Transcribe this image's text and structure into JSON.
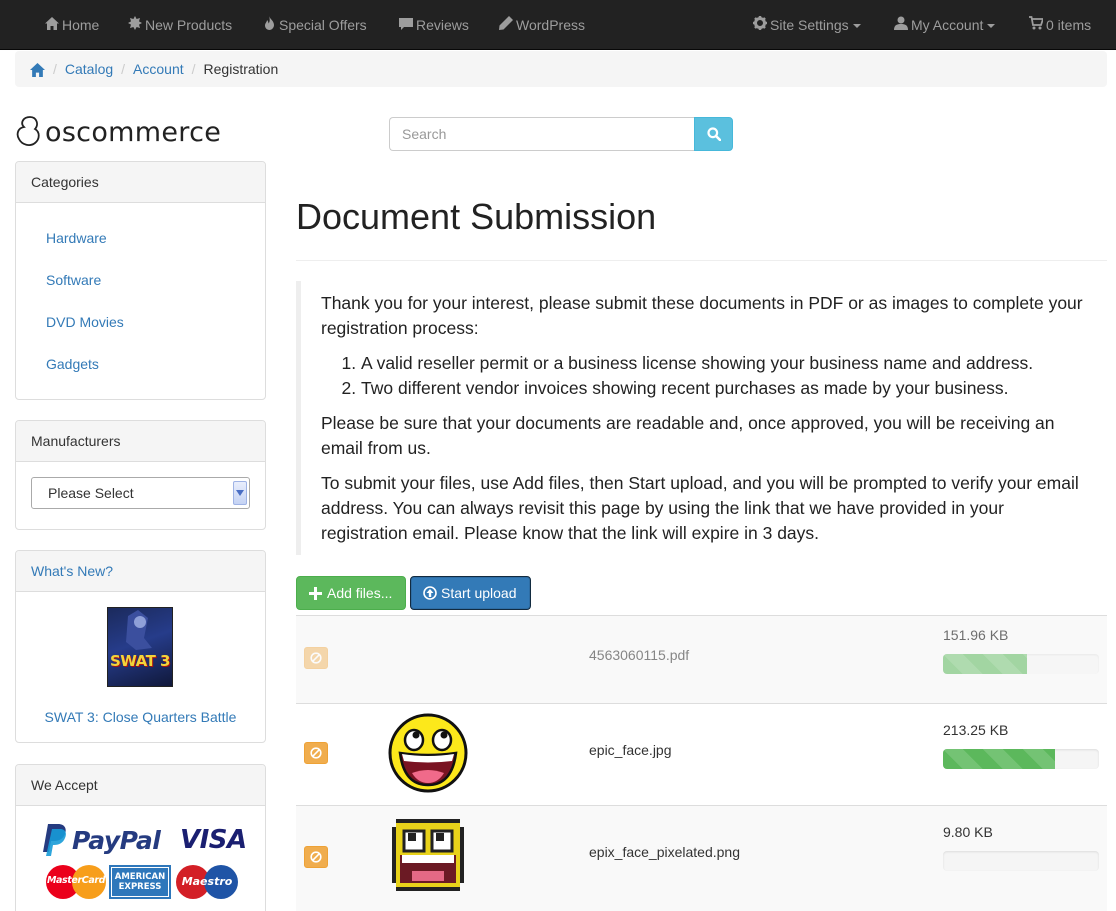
{
  "nav": {
    "left": [
      {
        "label": "Home",
        "icon": "home-icon"
      },
      {
        "label": "New Products",
        "icon": "certificate-icon"
      },
      {
        "label": "Special Offers",
        "icon": "fire-icon"
      },
      {
        "label": "Reviews",
        "icon": "comment-icon"
      },
      {
        "label": "WordPress",
        "icon": "pencil-icon"
      }
    ],
    "right": [
      {
        "label": "Site Settings",
        "icon": "cog-icon"
      },
      {
        "label": "My Account",
        "icon": "user-icon"
      },
      {
        "label": "0 items",
        "icon": "cart-icon"
      }
    ]
  },
  "breadcrumb": {
    "items": [
      "Catalog",
      "Account"
    ],
    "active": "Registration"
  },
  "logo": {
    "text": "oscommerce"
  },
  "search": {
    "placeholder": "Search"
  },
  "sidebar": {
    "categories": {
      "heading": "Categories",
      "items": [
        "Hardware",
        "Software",
        "DVD Movies",
        "Gadgets"
      ]
    },
    "manufacturers": {
      "heading": "Manufacturers",
      "selected": "Please Select"
    },
    "whats_new": {
      "heading": "What's New?",
      "product": "SWAT 3: Close Quarters Battle",
      "box_art_text": "SWAT 3"
    },
    "we_accept": {
      "heading": "We Accept",
      "logos": [
        "PayPal",
        "VISA",
        "MasterCard",
        "AMERICAN EXPRESS",
        "Maestro"
      ]
    }
  },
  "main": {
    "title": "Document Submission",
    "intro": "Thank you for your interest, please submit these documents in PDF or as images to complete your registration process:",
    "requirements": [
      "A valid reseller permit or a business license showing your business name and address.",
      "Two different vendor invoices showing recent purchases as made by your business."
    ],
    "note1": "Please be sure that your documents are readable and, once approved, you will be receiving an email from us.",
    "note2": "To submit your files, use Add files, then Start upload, and you will be prompted to verify your email address. You can always revisit this page by using the link that we have provided in your registration email. Please know that the link will expire in 3 days.",
    "add_label": "Add files...",
    "upload_label": "Start upload"
  },
  "files": [
    {
      "name": "4563060115.pdf",
      "size": "151.96 KB",
      "progress": 0.54,
      "faded": true
    },
    {
      "name": "epic_face.jpg",
      "size": "213.25 KB",
      "progress": 0.72,
      "faded": false
    },
    {
      "name": "epix_face_pixelated.png",
      "size": "9.80 KB",
      "progress": 0.0,
      "faded": false
    }
  ],
  "colors": {
    "navbar": "#222222",
    "link": "#337ab7",
    "success": "#5cb85c",
    "primary": "#337ab7",
    "warning": "#f0ad4e",
    "info": "#5bc0de"
  }
}
